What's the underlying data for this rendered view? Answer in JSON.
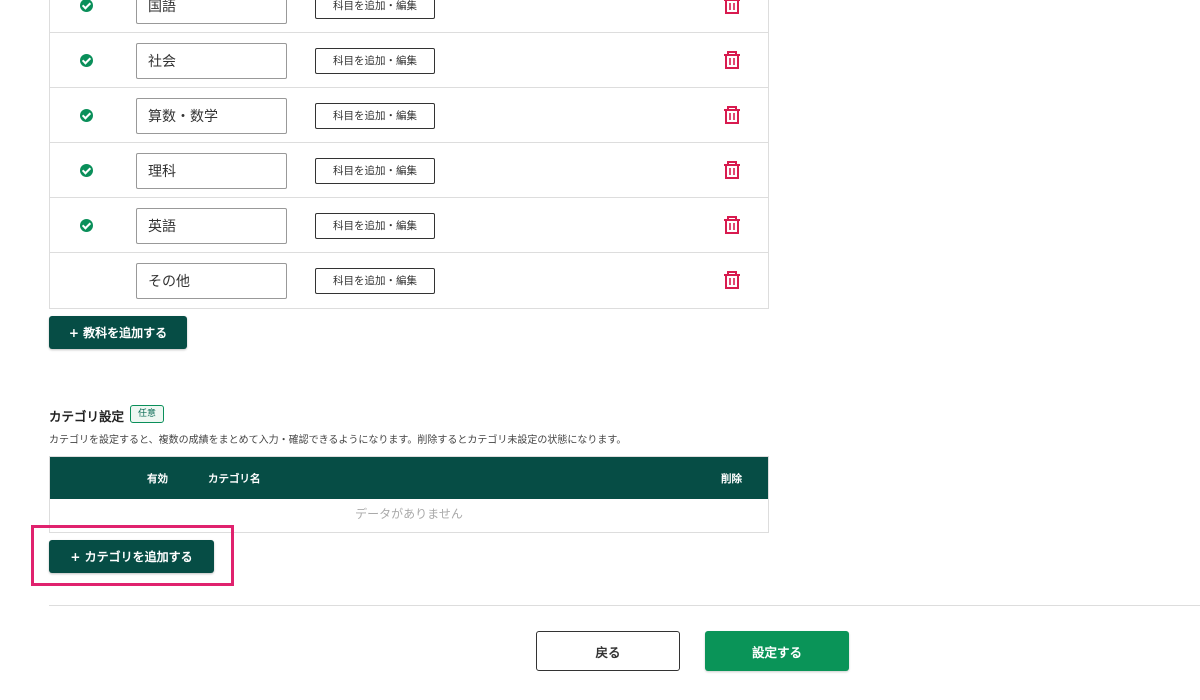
{
  "subjects": [
    {
      "name": "国語",
      "active": true,
      "edit_label": "科目を追加・編集"
    },
    {
      "name": "社会",
      "active": true,
      "edit_label": "科目を追加・編集"
    },
    {
      "name": "算数・数学",
      "active": true,
      "edit_label": "科目を追加・編集"
    },
    {
      "name": "理科",
      "active": true,
      "edit_label": "科目を追加・編集"
    },
    {
      "name": "英語",
      "active": true,
      "edit_label": "科目を追加・編集"
    },
    {
      "name": "その他",
      "active": false,
      "edit_label": "科目を追加・編集"
    }
  ],
  "add_subject_label": "+ 教科を追加する",
  "category": {
    "title": "カテゴリ設定",
    "badge": "任意",
    "description": "カテゴリを設定すると、複数の成績をまとめて入力・確認できるようになります。削除するとカテゴリ未設定の状態になります。",
    "headers": {
      "active": "有効",
      "name": "カテゴリ名",
      "delete": "削除"
    },
    "empty_text": "データがありません",
    "add_label": "+ カテゴリを追加する"
  },
  "footer": {
    "back_label": "戻る",
    "submit_label": "設定する"
  },
  "icons": {
    "check": "check-circle-icon",
    "delete": "trash-icon"
  },
  "colors": {
    "primary_dark": "#064d45",
    "primary": "#0a9458",
    "danger": "#d81b4f",
    "highlight": "#e0226e"
  }
}
